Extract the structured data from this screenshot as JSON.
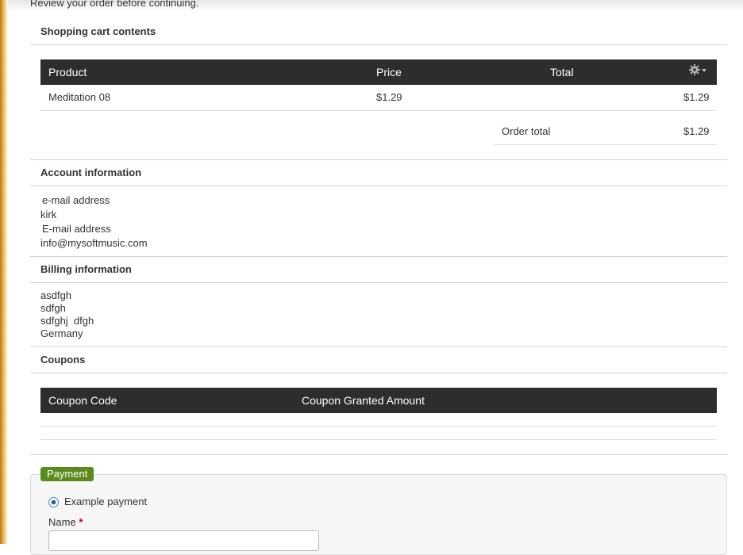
{
  "page": {
    "intro_text": "Review your order before continuing."
  },
  "cart": {
    "title": "Shopping cart contents",
    "columns": {
      "product": "Product",
      "price": "Price",
      "total": "Total"
    },
    "rows": [
      {
        "product": "Meditation 08",
        "price": "$1.29",
        "total": "$1.29"
      }
    ],
    "order_total_label": "Order total",
    "order_total_value": "$1.29"
  },
  "account": {
    "title": "Account information",
    "lines": [
      "e-mail address",
      "kirk",
      "E-mail address",
      "info@mysoftmusic.com"
    ]
  },
  "billing": {
    "title": "Billing information",
    "lines": [
      "asdfgh",
      "sdfgh",
      "sdfghj  dfgh",
      "Germany"
    ]
  },
  "coupons": {
    "title": "Coupons",
    "columns": {
      "code": "Coupon Code",
      "amount": "Coupon Granted Amount"
    }
  },
  "payment": {
    "legend": "Payment",
    "method_label": "Example payment",
    "name_label": "Name",
    "required_mark": "*",
    "name_value": ""
  },
  "icons": {
    "table_settings": "gear-icon",
    "payment_radio": "radio-selected"
  },
  "colors": {
    "table_header_bg": "#2d2d2d",
    "payment_legend_bg": "#5b8a1c",
    "required": "#cc0000"
  }
}
